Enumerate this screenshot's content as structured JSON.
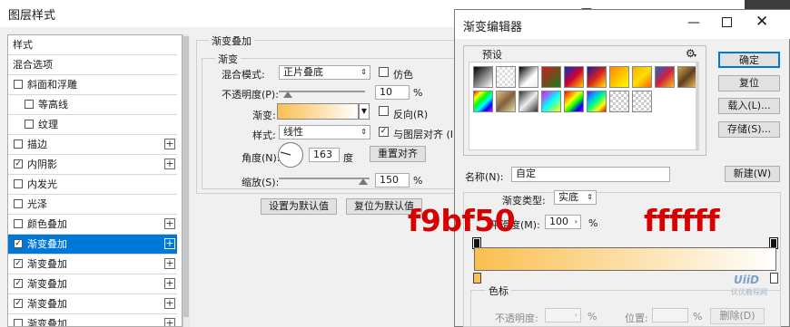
{
  "layer_style": {
    "title": "图层样式",
    "styles_list": [
      {
        "label": "样式",
        "checkbox": false,
        "checked": false,
        "plus": false,
        "indent": 0
      },
      {
        "label": "混合选项",
        "checkbox": false,
        "checked": false,
        "plus": false,
        "indent": 0
      },
      {
        "label": "斜面和浮雕",
        "checkbox": true,
        "checked": false,
        "plus": false,
        "indent": 0
      },
      {
        "label": "等高线",
        "checkbox": true,
        "checked": false,
        "plus": false,
        "indent": 1
      },
      {
        "label": "纹理",
        "checkbox": true,
        "checked": false,
        "plus": false,
        "indent": 1
      },
      {
        "label": "描边",
        "checkbox": true,
        "checked": false,
        "plus": true,
        "indent": 0
      },
      {
        "label": "内阴影",
        "checkbox": true,
        "checked": true,
        "plus": true,
        "indent": 0
      },
      {
        "label": "内发光",
        "checkbox": true,
        "checked": false,
        "plus": false,
        "indent": 0
      },
      {
        "label": "光泽",
        "checkbox": true,
        "checked": false,
        "plus": false,
        "indent": 0
      },
      {
        "label": "颜色叠加",
        "checkbox": true,
        "checked": false,
        "plus": true,
        "indent": 0
      },
      {
        "label": "渐变叠加",
        "checkbox": true,
        "checked": true,
        "plus": true,
        "indent": 0,
        "selected": true
      },
      {
        "label": "渐变叠加",
        "checkbox": true,
        "checked": true,
        "plus": true,
        "indent": 0
      },
      {
        "label": "渐变叠加",
        "checkbox": true,
        "checked": true,
        "plus": true,
        "indent": 0
      },
      {
        "label": "渐变叠加",
        "checkbox": true,
        "checked": true,
        "plus": true,
        "indent": 0
      },
      {
        "label": "渐变叠加",
        "checkbox": true,
        "checked": false,
        "plus": true,
        "indent": 0
      }
    ],
    "panel": {
      "section_title": "渐变叠加",
      "group_title": "渐变",
      "blend_mode_label": "混合模式:",
      "blend_mode_value": "正片叠底",
      "dither_label": "仿色",
      "opacity_label": "不透明度(P):",
      "opacity_value": "10",
      "opacity_unit": "%",
      "opacity_level": 0.1,
      "gradient_label": "渐变:",
      "reverse_label": "反向(R)",
      "style_label": "样式:",
      "style_value": "线性",
      "align_label": "与图层对齐 (I)",
      "angle_label": "角度(N):",
      "angle_value": "163",
      "angle_unit": "度",
      "reset_align_button": "重置对齐",
      "scale_label": "缩放(S):",
      "scale_value": "150",
      "scale_unit": "%",
      "make_default_button": "设置为默认值",
      "reset_default_button": "复位为默认值"
    }
  },
  "gradient_editor": {
    "title": "渐变编辑器",
    "presets_label": "预设",
    "ok_button": "确定",
    "reset_button": "复位",
    "load_button": "载入(L)...",
    "save_button": "存储(S)...",
    "name_label": "名称(N):",
    "name_value": "自定",
    "new_button": "新建(W)",
    "gradient_type_label": "渐变类型:",
    "gradient_type_value": "实底",
    "smoothness_label": "平滑度(M):",
    "smoothness_value": "100",
    "smoothness_unit": "%",
    "color_stops_label": "色标",
    "stop_opacity_label": "不透明度:",
    "stop_opacity_unit": "%",
    "location_label": "位置:",
    "location_unit": "%",
    "delete_button": "删除(D)",
    "gradient_colors": [
      "#f9bf50",
      "#ffffff"
    ],
    "annotation_left": "f9bf50",
    "annotation_right": "ffffff",
    "watermark_text": "优优教程网"
  },
  "colors": {
    "selection": "#0078d7",
    "annotation": "#d70000",
    "gradient_start": "#f9bf50",
    "gradient_end": "#ffffff"
  }
}
